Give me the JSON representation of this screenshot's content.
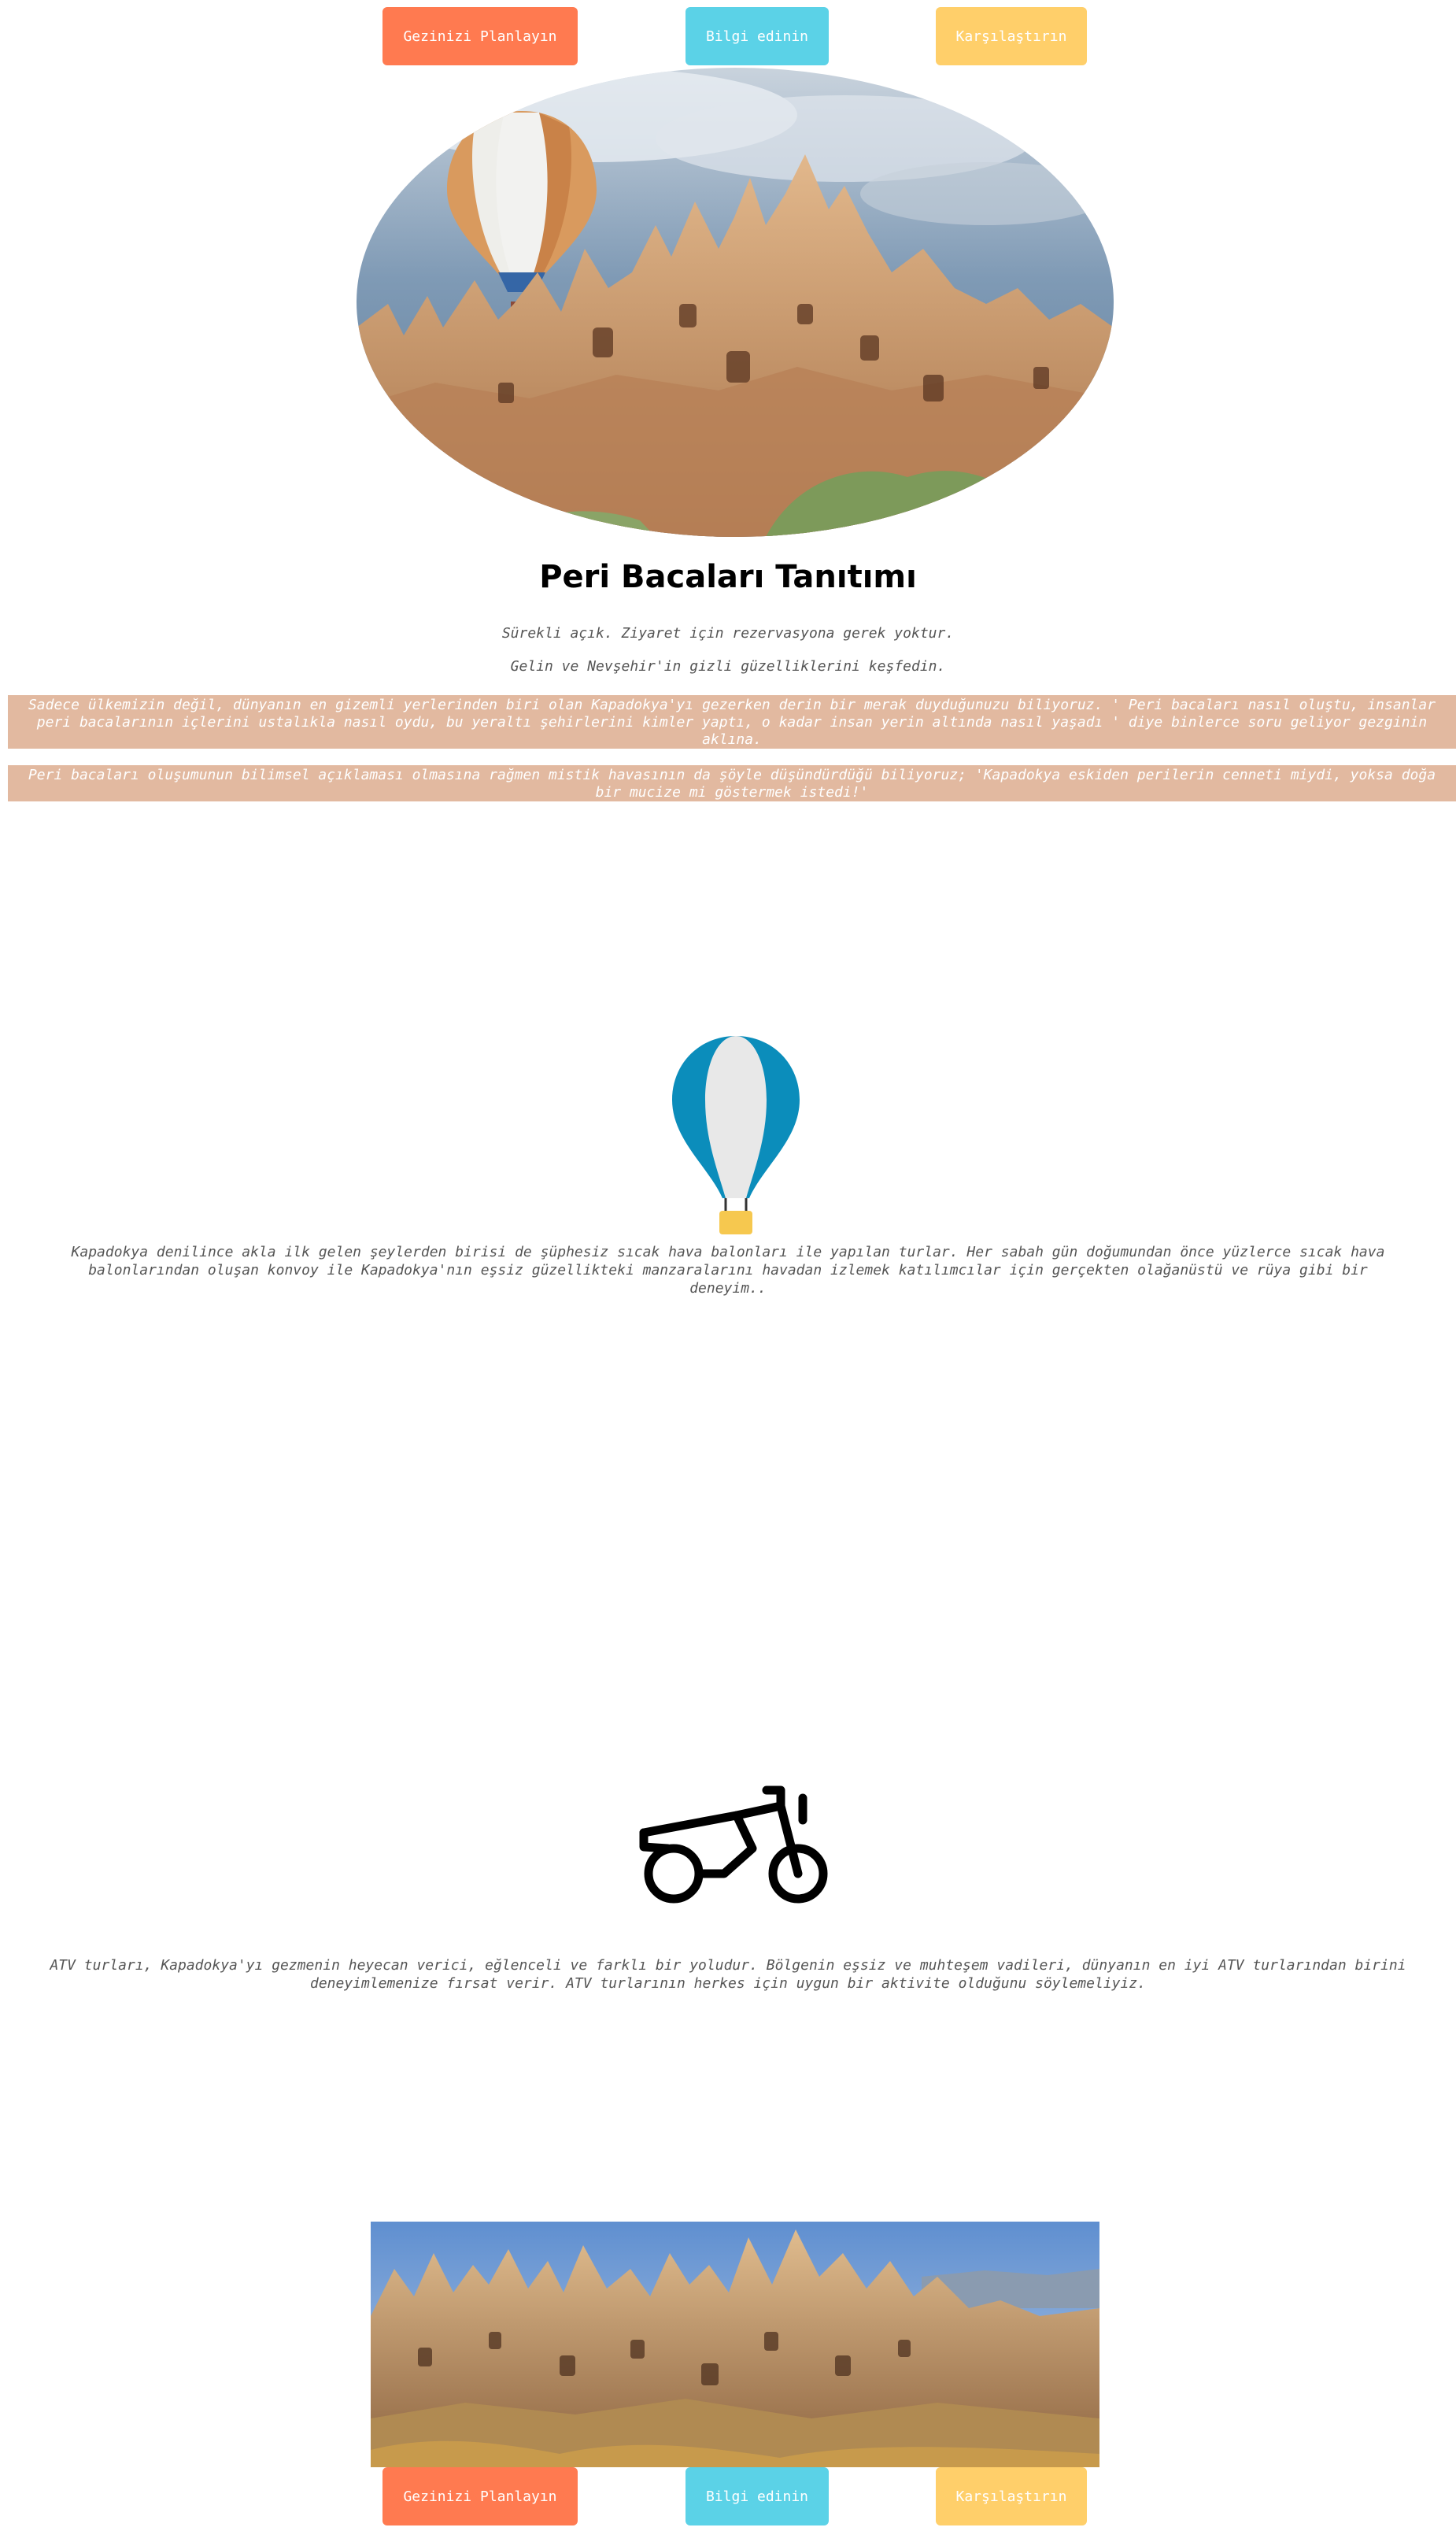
{
  "nav_top": {
    "plan_label": "Gezinizi Planlayın",
    "info_label": "Bilgi edinin",
    "compare_label": "Karşılaştırın"
  },
  "intro": {
    "title": "Peri Bacaları Tanıtımı",
    "subtitle_1": "Sürekli açık. Ziyaret için rezervasyona gerek yoktur.",
    "subtitle_2": "Gelin ve Nevşehir'in gizli güzelliklerini keşfedin.",
    "band_1": "Sadece ülkemizin değil, dünyanın en gizemli yerlerinden biri olan Kapadokya'yı gezerken derin bir merak duyduğunuzu biliyoruz. ' Peri bacaları nasıl oluştu, insanlar peri bacalarının içlerini ustalıkla nasıl oydu, bu yeraltı şehirlerini kimler yaptı, o kadar insan yerin altında nasıl yaşadı ' diye binlerce soru geliyor gezginin aklına.",
    "band_2": "Peri bacaları oluşumunun bilimsel açıklaması olmasına rağmen mistik havasının da şöyle düşündürdüğü biliyoruz; 'Kapadokya eskiden perilerin cenneti miydi, yoksa doğa bir mucize mi göstermek istedi!'"
  },
  "balloon_section": {
    "icon": "hot-air-balloon-icon",
    "text": "Kapadokya denilince akla ilk gelen şeylerden birisi de şüphesiz sıcak hava balonları ile yapılan turlar. Her sabah gün doğumundan önce yüzlerce sıcak hava balonlarından oluşan konvoy ile Kapadokya'nın eşsiz güzellikteki manzaralarını havadan izlemek katılımcılar için gerçekten olağanüstü ve rüya gibi bir deneyim.."
  },
  "atv_section": {
    "icon": "atv-motorbike-icon",
    "text": "ATV turları, Kapadokya'yı gezmenin heyecan verici, eğlenceli ve farklı bir yoludur. Bölgenin eşsiz ve muhteşem vadileri, dünyanın en iyi ATV turlarından birini deneyimlemenize fırsat verir. ATV turlarının herkes için uygun bir aktivite olduğunu söylemeliyiz."
  },
  "nav_bottom": {
    "plan_label": "Gezinizi Planlayın",
    "info_label": "Bilgi edinin",
    "compare_label": "Karşılaştırın"
  },
  "colors": {
    "plan_button": "#ff7a50",
    "info_button": "#5bd2e7",
    "compare_button": "#ffcf6a",
    "band_background": "#e2b9a0",
    "balloon_blue": "#0b8dbb",
    "balloon_basket": "#f6c84f"
  }
}
